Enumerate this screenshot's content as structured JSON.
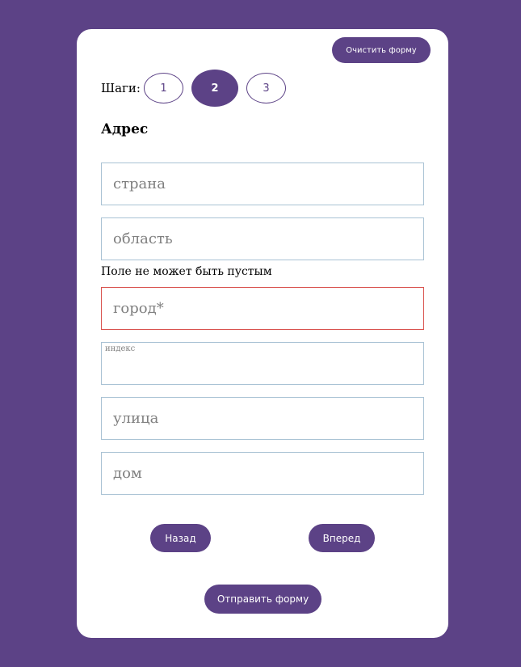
{
  "header": {
    "clear_label": "Очистить форму"
  },
  "steps": {
    "label": "Шаги:",
    "items": [
      "1",
      "2",
      "3"
    ],
    "active": 2
  },
  "section": {
    "title": "Адрес"
  },
  "fields": {
    "country": {
      "placeholder": "страна",
      "value": ""
    },
    "region": {
      "placeholder": "область",
      "value": ""
    },
    "region_error": "Поле не может быть пустым",
    "city": {
      "placeholder": "город*",
      "value": ""
    },
    "zip": {
      "label": "индекс",
      "value": ""
    },
    "street": {
      "placeholder": "улица",
      "value": ""
    },
    "house": {
      "placeholder": "дом",
      "value": ""
    }
  },
  "nav": {
    "back_label": "Назад",
    "next_label": "Вперед"
  },
  "submit": {
    "label": "Отправить форму"
  },
  "colors": {
    "accent": "#5c4286",
    "field_border": "#a9c2d4",
    "error_border": "#d9534f"
  }
}
